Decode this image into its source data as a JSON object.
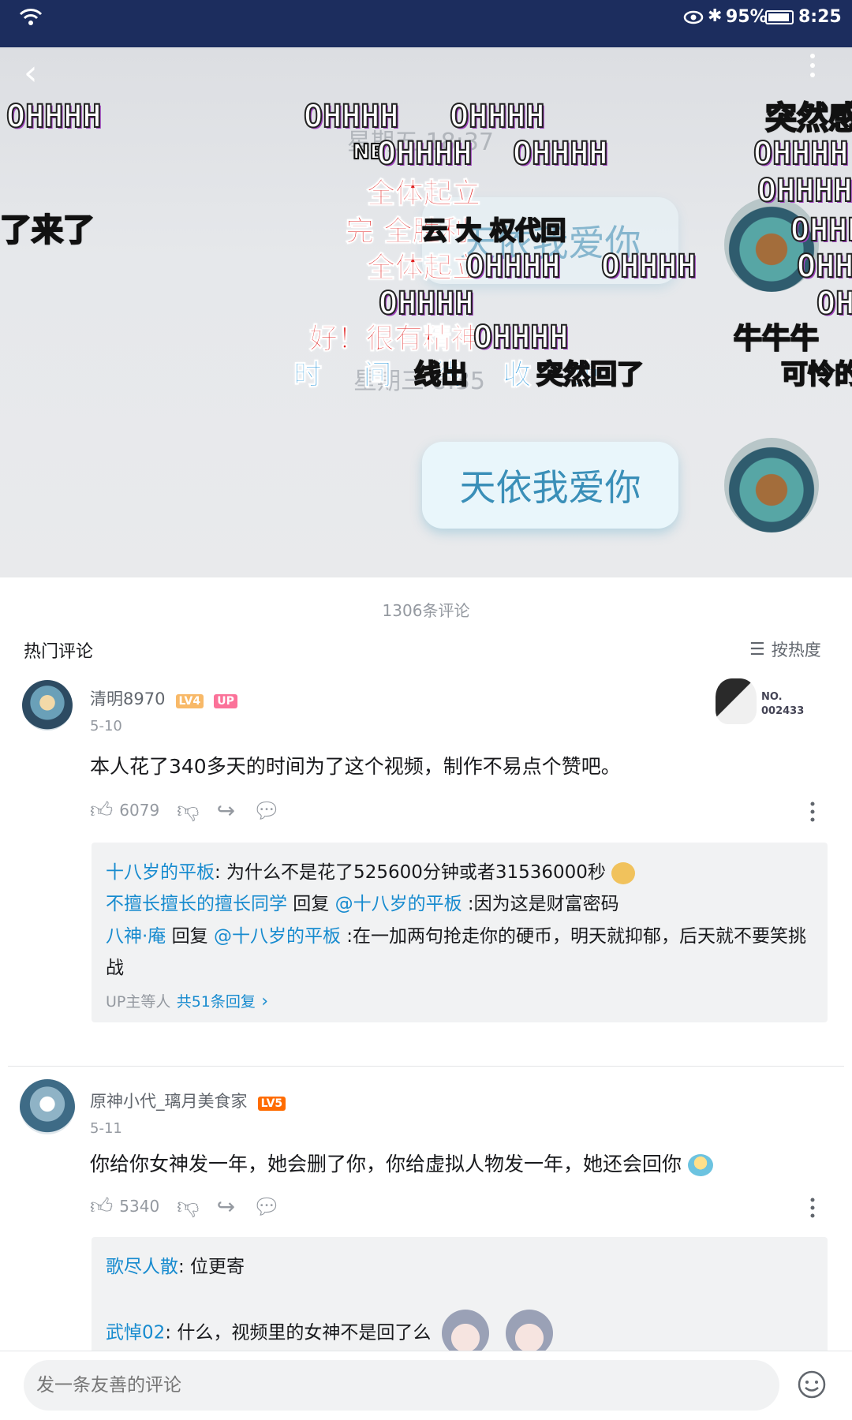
{
  "status": {
    "battery": "95%",
    "time": "8:25"
  },
  "video": {
    "bubble1_text": "天依我爱你",
    "bubble2_text": "天依我爱你",
    "ghost_time1": "星期五 18:37",
    "ghost_time2": "星期三 8:35",
    "danmaku": [
      "OHHHH",
      "OHHHH",
      "OHHHH",
      "突然感",
      "NE",
      "OHHHH",
      "OHHHH",
      "OHHHH",
      "全体起立",
      "OHHHH",
      "了来了",
      "完 全胜利",
      "云 大 权代回",
      "OHHHH",
      "全体起立",
      "OHHHH",
      "OHHHH",
      "OHHHH",
      "OHHHH",
      "OHHHH",
      "好！很有精神！",
      "OHHHH",
      "牛牛牛",
      "时 间 线 收 束",
      "线出",
      "突然回了",
      "可怜的"
    ]
  },
  "comments": {
    "count_text": "1306条评论",
    "hot_label": "热门评论",
    "sort_label": "按热度",
    "items": [
      {
        "user": "清明8970",
        "level": "LV4",
        "up_badge": "UP",
        "date": "5-10",
        "text": "本人花了340多天的时间为了这个视频，制作不易点个赞吧。",
        "likes": "6079",
        "badge_no": "NO.",
        "badge_num": "002433",
        "replies": [
          {
            "user": "十八岁的平板",
            "sep": ":",
            "text": " 为什么不是花了525600分钟或者31536000秒"
          },
          {
            "user": "不擅长擅长的擅长同学",
            "mid": " 回复 ",
            "mention": "@十八岁的平板",
            "text": " :因为这是财富密码"
          },
          {
            "user": "八神·庵",
            "mid": " 回复 ",
            "mention": "@十八岁的平板",
            "text": " :在一加两句抢走你的硬币，明天就抑郁，后天就不要笑挑战"
          }
        ],
        "more_prefix": "UP主等人",
        "more_link": "共51条回复"
      },
      {
        "user": "原神小代_璃月美食家",
        "level": "LV5",
        "date": "5-11",
        "text": "你给你女神发一年，她会删了你，你给虚拟人物发一年，她还会回你",
        "likes": "5340",
        "replies": [
          {
            "user": "歌尽人散",
            "sep": ":",
            "text": " 位更寄"
          },
          {
            "user": "武悼02",
            "sep": ":",
            "text": " 什么，视频里的女神不是回了么"
          }
        ]
      }
    ]
  },
  "input": {
    "placeholder": "发一条友善的评论"
  }
}
